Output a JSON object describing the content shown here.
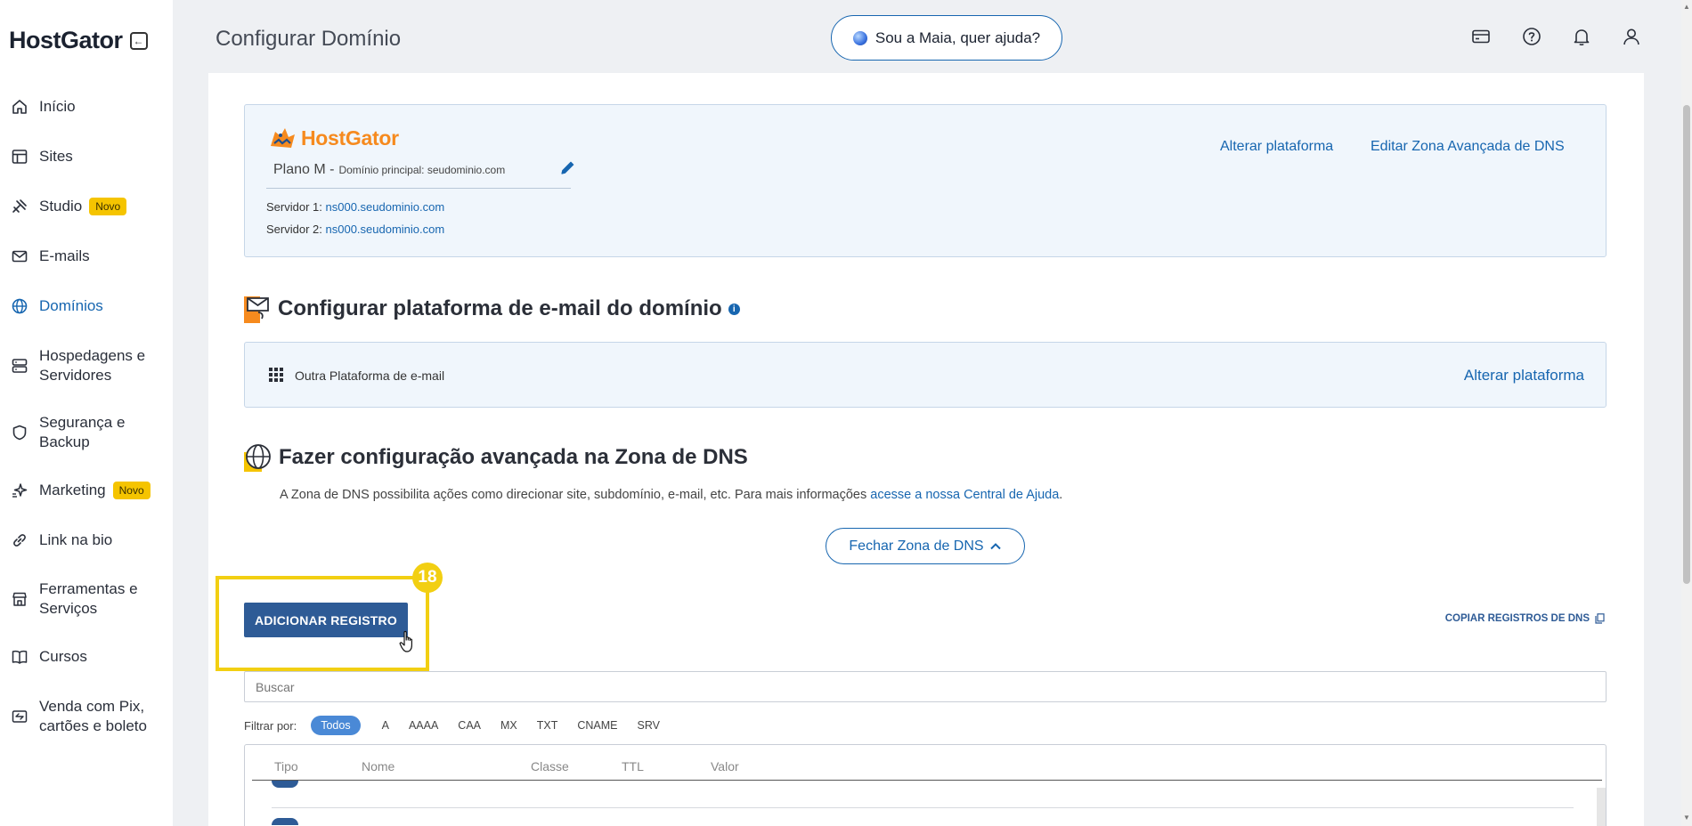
{
  "sidebar": {
    "logo": "HostGator",
    "items": [
      {
        "label": "Início",
        "icon": "home-icon"
      },
      {
        "label": "Sites",
        "icon": "layout-icon"
      },
      {
        "label": "Studio",
        "icon": "studio-icon",
        "badge": "Novo"
      },
      {
        "label": "E-mails",
        "icon": "mail-icon"
      },
      {
        "label": "Domínios",
        "icon": "globe-icon",
        "active": true
      },
      {
        "label": "Hospedagens e Servidores",
        "icon": "server-icon"
      },
      {
        "label": "Segurança e Backup",
        "icon": "shield-icon"
      },
      {
        "label": "Marketing",
        "icon": "sparkle-icon",
        "badge": "Novo"
      },
      {
        "label": "Link na bio",
        "icon": "link-icon"
      },
      {
        "label": "Ferramentas e Serviços",
        "icon": "store-icon"
      },
      {
        "label": "Cursos",
        "icon": "book-icon"
      },
      {
        "label": "Venda com Pix, cartões e boleto",
        "icon": "payment-icon"
      }
    ]
  },
  "header": {
    "title": "Configurar Domínio",
    "help_label": "Sou a Maia, quer ajuda?",
    "icons": [
      "card-icon",
      "help-icon",
      "bell-icon",
      "user-icon"
    ]
  },
  "domain_panel": {
    "brand": "HostGator",
    "plan": "Plano M -",
    "plan_sub": "Domínio principal: seudominio.com",
    "server1_label": "Servidor 1:",
    "server1_value": "ns000.seudominio.com",
    "server2_label": "Servidor 2:",
    "server2_value": "ns000.seudominio.com",
    "link_change": "Alterar plataforma",
    "link_edit_dns": "Editar Zona Avançada de DNS"
  },
  "email_section": {
    "title": "Configurar plataforma de e-mail do domínio",
    "platform": "Outra Plataforma de e-mail",
    "link_change": "Alterar plataforma"
  },
  "dns_section": {
    "title": "Fazer configuração avançada na Zona de DNS",
    "desc": "A Zona de DNS possibilita ações como direcionar site, subdomínio, e-mail, etc. Para mais informações ",
    "desc_link": "acesse a nossa Central de Ajuda",
    "desc_end": ".",
    "close_label": "Fechar Zona de DNS",
    "add_label": "ADICIONAR REGISTRO",
    "step_number": "18",
    "copy_label": "COPIAR REGISTROS DE DNS",
    "search_placeholder": "Buscar",
    "filter_label": "Filtrar por:",
    "filters": [
      "Todos",
      "A",
      "AAAA",
      "CAA",
      "MX",
      "TXT",
      "CNAME",
      "SRV"
    ],
    "columns": [
      "Tipo",
      "Nome",
      "Classe",
      "TTL",
      "Valor"
    ]
  },
  "colors": {
    "accent": "#1766b0",
    "brand_orange": "#f68a1e",
    "button_dark": "#2e5b96",
    "highlight": "#f2cf12",
    "badge": "#f5c400"
  }
}
